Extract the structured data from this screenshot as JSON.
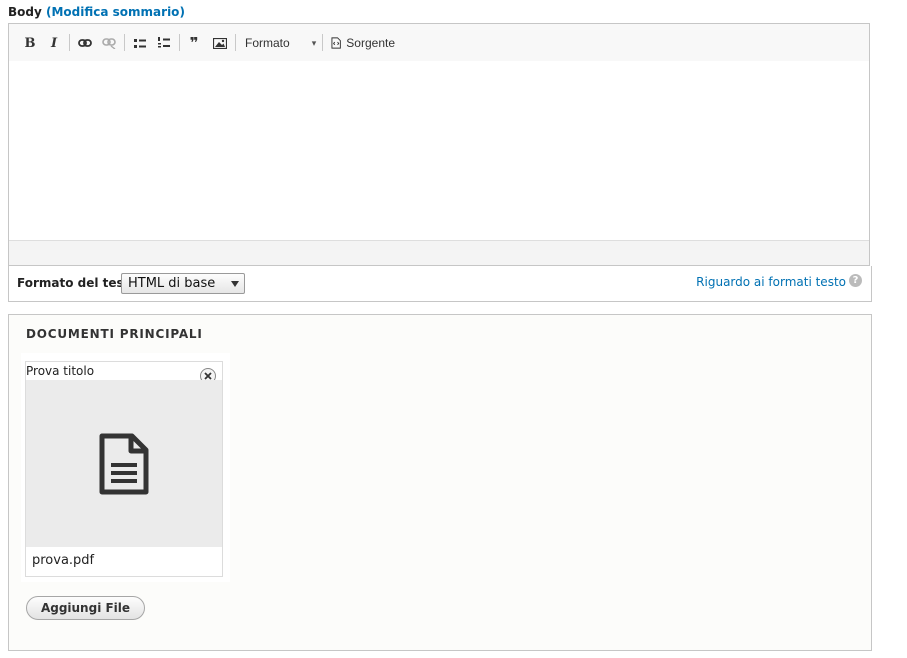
{
  "body_field": {
    "label": "Body",
    "open_paren": "(",
    "summary_link": "Modifica sommario",
    "close_paren": ")"
  },
  "toolbar": {
    "bold": "B",
    "italic": "I",
    "quote": "❞",
    "format_label": "Formato",
    "format_arrow": "▾",
    "source_label": "Sorgente"
  },
  "text_format": {
    "label": "Formato del testo",
    "selected": "HTML di base",
    "help_link": "Riguardo ai formati testo",
    "help_icon": "?"
  },
  "documents": {
    "legend": "DOCUMENTI PRINCIPALI",
    "files": [
      {
        "title": "Prova titolo",
        "file_name": "prova.pdf",
        "icon": "document-icon"
      }
    ],
    "add_button": "Aggiungi File"
  }
}
